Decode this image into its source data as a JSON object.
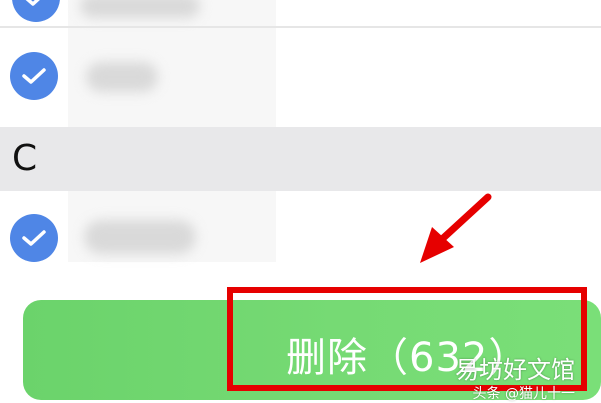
{
  "contacts": {
    "section_letter": "C",
    "checked_color": "#4f86e6"
  },
  "action": {
    "delete_label": "删除（632）",
    "button_color": "#76da74",
    "highlight_color": "#e60000",
    "arrow_color": "#e60000"
  },
  "watermark": {
    "main": "易坊好文馆",
    "sub": "头条 @猫儿十一"
  }
}
